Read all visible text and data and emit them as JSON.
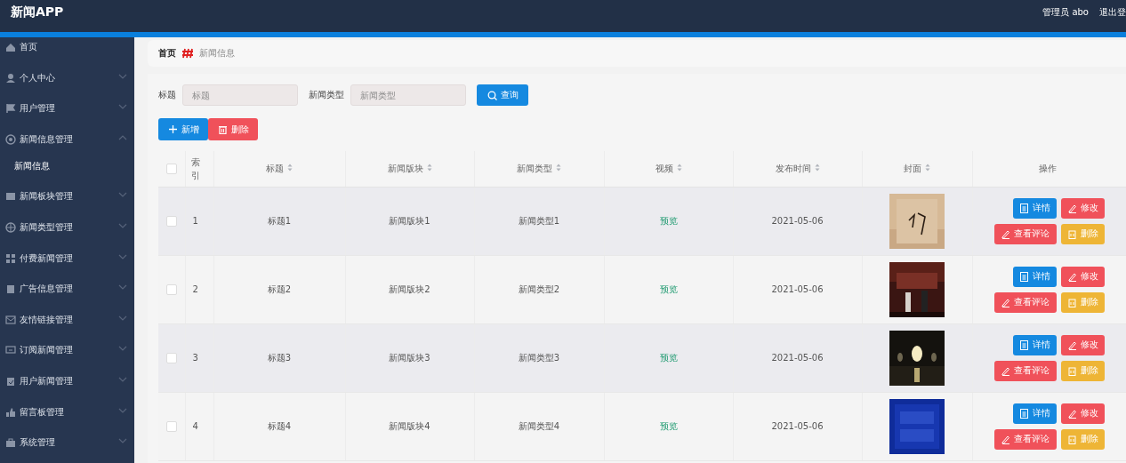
{
  "header": {
    "title": "新闻APP",
    "user": "管理员 abo",
    "logout": "退出登"
  },
  "sidebar": {
    "items": [
      {
        "label": "首页",
        "kind": "link"
      },
      {
        "label": "个人中心",
        "kind": "submenu",
        "expanded": false
      },
      {
        "label": "用户管理",
        "kind": "submenu",
        "expanded": false
      },
      {
        "label": "新闻信息管理",
        "kind": "submenu",
        "expanded": true,
        "children": [
          {
            "label": "新闻信息"
          }
        ]
      },
      {
        "label": "新闻板块管理",
        "kind": "submenu",
        "expanded": false
      },
      {
        "label": "新闻类型管理",
        "kind": "submenu",
        "expanded": false
      },
      {
        "label": "付费新闻管理",
        "kind": "submenu",
        "expanded": false
      },
      {
        "label": "广告信息管理",
        "kind": "submenu",
        "expanded": false
      },
      {
        "label": "友情链接管理",
        "kind": "submenu",
        "expanded": false
      },
      {
        "label": "订阅新闻管理",
        "kind": "submenu",
        "expanded": false
      },
      {
        "label": "用户新闻管理",
        "kind": "submenu",
        "expanded": false
      },
      {
        "label": "留言板管理",
        "kind": "submenu",
        "expanded": false
      },
      {
        "label": "系统管理",
        "kind": "submenu",
        "expanded": false
      }
    ]
  },
  "breadcrumb": [
    "首页",
    "新闻信息"
  ],
  "search": {
    "fields": [
      {
        "label": "标题",
        "placeholder": "标题"
      },
      {
        "label": "新闻类型",
        "placeholder": "新闻类型"
      }
    ],
    "button": "查询"
  },
  "actions": [
    {
      "label": "新增",
      "kind": "add"
    },
    {
      "label": "删除",
      "kind": "delete"
    }
  ],
  "table": {
    "header_checked": false,
    "columns": [
      {
        "label": "索引",
        "sortable": false
      },
      {
        "label": "标题",
        "sortable": true
      },
      {
        "label": "新闻版块",
        "sortable": true
      },
      {
        "label": "新闻类型",
        "sortable": true
      },
      {
        "label": "视频",
        "sortable": true
      },
      {
        "label": "发布时间",
        "sortable": true
      },
      {
        "label": "封面",
        "sortable": true
      },
      {
        "label": "操作",
        "sortable": false
      }
    ],
    "rows": [
      {
        "checked": false,
        "index": "1",
        "title": "标题1",
        "block": "新闻版块1",
        "type": "新闻类型1",
        "video": "预览",
        "date": "2021-05-06",
        "actions": [
          {
            "label": "详情",
            "kind": "detail"
          },
          {
            "label": "修改",
            "kind": "edit"
          },
          {
            "label": "查看评论",
            "kind": "comment"
          },
          {
            "label": "删除",
            "kind": "delete"
          }
        ]
      },
      {
        "checked": false,
        "index": "2",
        "title": "标题2",
        "block": "新闻版块2",
        "type": "新闻类型2",
        "video": "预览",
        "date": "2021-05-06",
        "actions": [
          {
            "label": "详情",
            "kind": "detail"
          },
          {
            "label": "修改",
            "kind": "edit"
          },
          {
            "label": "查看评论",
            "kind": "comment"
          },
          {
            "label": "删除",
            "kind": "delete"
          }
        ]
      },
      {
        "checked": false,
        "index": "3",
        "title": "标题3",
        "block": "新闻版块3",
        "type": "新闻类型3",
        "video": "预览",
        "date": "2021-05-06",
        "actions": [
          {
            "label": "详情",
            "kind": "detail"
          },
          {
            "label": "修改",
            "kind": "edit"
          },
          {
            "label": "查看评论",
            "kind": "comment"
          },
          {
            "label": "删除",
            "kind": "delete"
          }
        ]
      },
      {
        "checked": false,
        "index": "4",
        "title": "标题4",
        "block": "新闻版块4",
        "type": "新闻类型4",
        "video": "预览",
        "date": "2021-05-06",
        "actions": [
          {
            "label": "详情",
            "kind": "detail"
          },
          {
            "label": "修改",
            "kind": "edit"
          },
          {
            "label": "查看评论",
            "kind": "comment"
          },
          {
            "label": "删除",
            "kind": "delete"
          }
        ]
      }
    ]
  }
}
